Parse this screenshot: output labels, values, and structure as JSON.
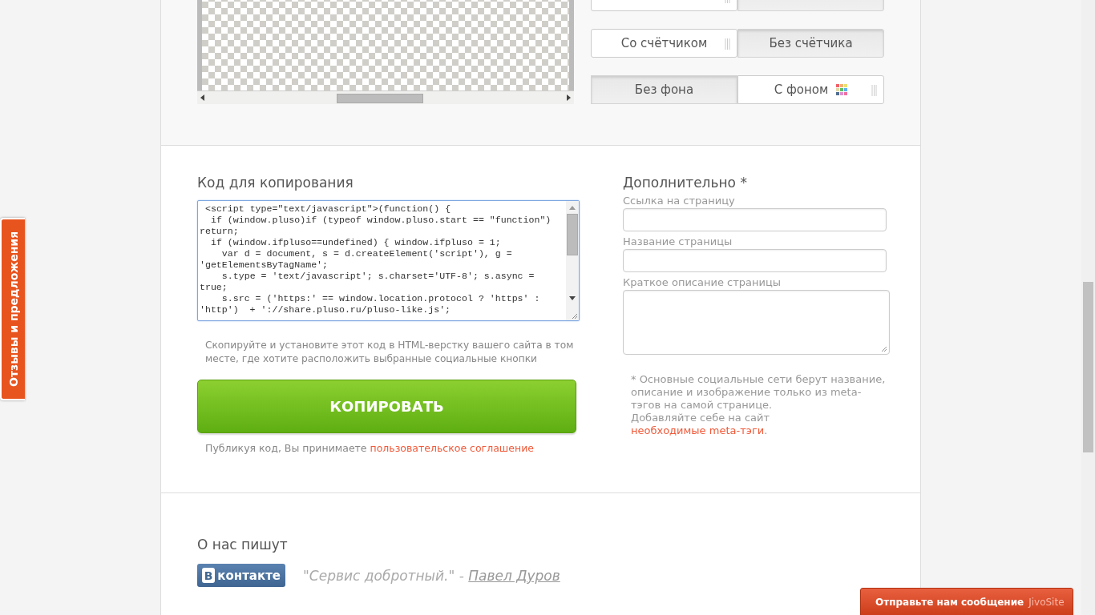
{
  "feedback_tab": {
    "label": "Отзывы и предложения"
  },
  "toggle_groups": [
    {
      "options": [
        {
          "selected": true,
          "kind": "plain"
        },
        {
          "selected": false,
          "kind": "plain"
        }
      ]
    },
    {
      "options": [
        {
          "label": "Со счётчиком",
          "selected": true,
          "kind": "plain"
        },
        {
          "label": "Без счётчика",
          "selected": false,
          "kind": "plain"
        }
      ]
    },
    {
      "options": [
        {
          "label": "Без фона",
          "selected": false,
          "kind": "plain"
        },
        {
          "label": "С фоном",
          "selected": true,
          "kind": "swatch"
        }
      ]
    }
  ],
  "code_section": {
    "title": "Код для копирования",
    "code": " <script type=\"text/javascript\">(function() {\n  if (window.pluso)if (typeof window.pluso.start == \"function\") return;\n  if (window.ifpluso==undefined) { window.ifpluso = 1;\n    var d = document, s = d.createElement('script'), g = 'getElementsByTagName';\n    s.type = 'text/javascript'; s.charset='UTF-8'; s.async = true;\n    s.src = ('https:' == window.location.protocol ? 'https' : 'http')  + '://share.pluso.ru/pluso-like.js';",
    "hint": "Скопируйте и установите этот код в HTML-верстку вашего сайта в том месте, где хотите расположить выбранные социальные кнопки",
    "copy_button": "КОПИРОВАТЬ",
    "agreement_text": "Публикуя код, Вы принимаете ",
    "agreement_link": "пользовательское соглашение"
  },
  "extra": {
    "title": "Дополнительно *",
    "fields": [
      {
        "label": "Ссылка на страницу",
        "kind": "input"
      },
      {
        "label": "Название страницы",
        "kind": "input"
      },
      {
        "label": "Краткое описание страницы",
        "kind": "textarea"
      }
    ],
    "note": "* Основные социальные сети берут название, описание и изображение только из meta-тэгов на самой странице.",
    "note2_text": "Добавляйте себе на сайт ",
    "note2_link": "необходимые meta-тэги",
    "note2_end": "."
  },
  "press": {
    "title": "О нас пишут",
    "logo_letter": "В",
    "logo_text": "контакте",
    "quote": "\"Сервис добротный.\" - ",
    "author": "Павел Дуров"
  },
  "chat_bar": {
    "label": "Отправьте нам сообщение",
    "brand": "JivoSite"
  }
}
